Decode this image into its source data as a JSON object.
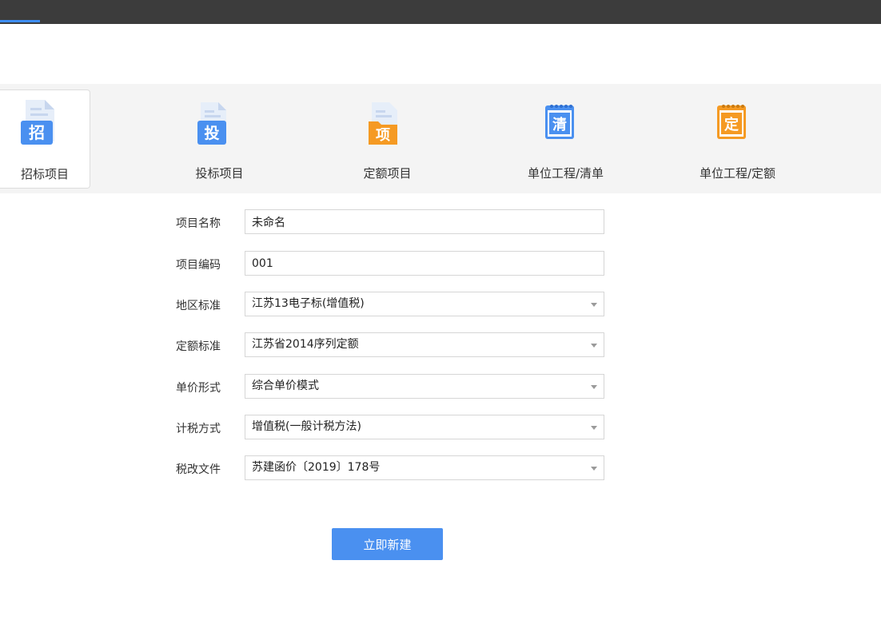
{
  "project_types": [
    {
      "label": "招标项目",
      "glyph": "招",
      "icon": "tender-doc-icon",
      "color": "#4a90f0",
      "selected": true
    },
    {
      "label": "投标项目",
      "glyph": "投",
      "icon": "bid-doc-icon",
      "color": "#4a90f0",
      "selected": false
    },
    {
      "label": "定额项目",
      "glyph": "项",
      "icon": "quota-folder-icon",
      "color": "#f59a23",
      "selected": false
    },
    {
      "label": "单位工程/清单",
      "glyph": "清",
      "icon": "bill-notepad-icon",
      "color": "#4a90f0",
      "selected": false
    },
    {
      "label": "单位工程/定额",
      "glyph": "定",
      "icon": "quota-notepad-icon",
      "color": "#f59a23",
      "selected": false
    }
  ],
  "form": {
    "name": {
      "label": "项目名称",
      "value": "未命名"
    },
    "code": {
      "label": "项目编码",
      "value": "001"
    },
    "region": {
      "label": "地区标准",
      "value": "江苏13电子标(增值税)"
    },
    "quota": {
      "label": "定额标准",
      "value": "江苏省2014序列定额"
    },
    "price": {
      "label": "单价形式",
      "value": "综合单价模式"
    },
    "tax": {
      "label": "计税方式",
      "value": "增值税(一般计税方法)"
    },
    "doc": {
      "label": "税改文件",
      "value": "苏建函价〔2019〕178号"
    }
  },
  "create_button": "立即新建",
  "colors": {
    "accent": "#4a90f0",
    "orange": "#f59a23",
    "topbar": "#3c3c3c",
    "strip": "#f4f4f4"
  }
}
